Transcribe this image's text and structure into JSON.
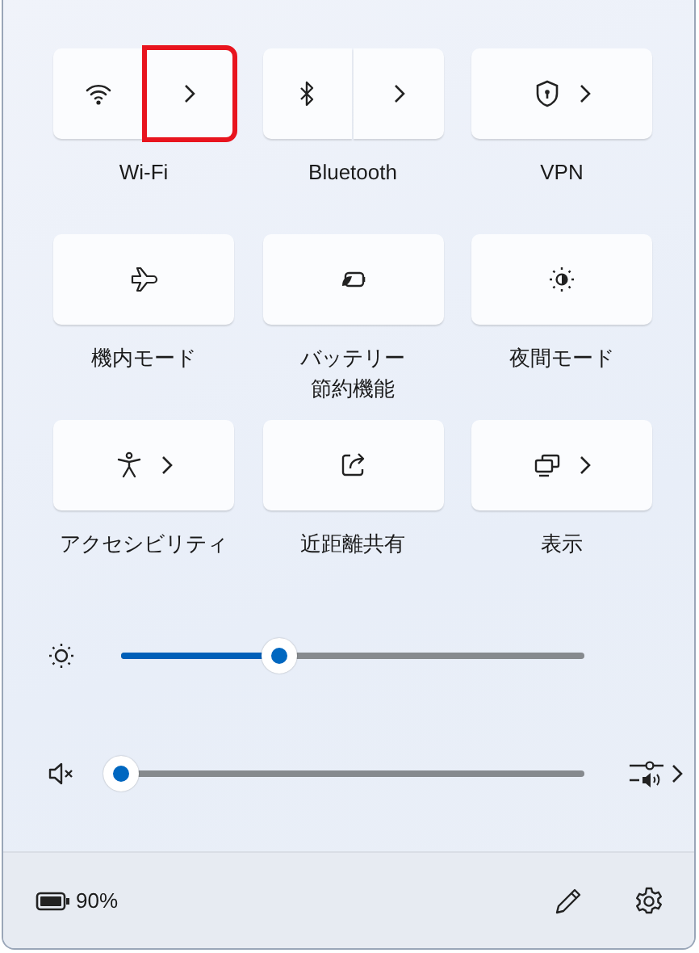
{
  "tiles": [
    {
      "lines": [
        "Wi-Fi"
      ],
      "kind": "split",
      "on": false,
      "highlighted": true
    },
    {
      "lines": [
        "Bluetooth"
      ],
      "kind": "split",
      "on": false,
      "highlighted": false
    },
    {
      "lines": [
        "VPN"
      ],
      "kind": "chevron",
      "on": false,
      "highlighted": false
    },
    {
      "lines": [
        "機内モード"
      ],
      "kind": "single",
      "on": false,
      "highlighted": false
    },
    {
      "lines": [
        "バッテリー",
        "節約機能"
      ],
      "kind": "single",
      "on": false,
      "highlighted": false
    },
    {
      "lines": [
        "夜間モード"
      ],
      "kind": "single",
      "on": false,
      "highlighted": false
    },
    {
      "lines": [
        "アクセシビリティ"
      ],
      "kind": "chevron",
      "on": false,
      "highlighted": false
    },
    {
      "lines": [
        "近距離共有"
      ],
      "kind": "single",
      "on": false,
      "highlighted": false
    },
    {
      "lines": [
        "表示"
      ],
      "kind": "chevron",
      "on": false,
      "highlighted": false
    }
  ],
  "sliders": [
    {
      "kind": "brightness",
      "level": 0.34
    },
    {
      "kind": "volume",
      "level": 0
    }
  ],
  "footer": {
    "battery": "90%"
  }
}
